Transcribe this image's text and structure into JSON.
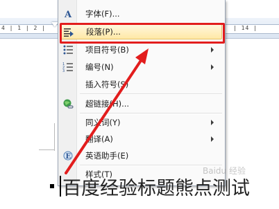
{
  "ruler": {
    "left_numbers": "4 | 1 | 2 |",
    "right_numbers": "| 14 |"
  },
  "context_menu": {
    "items": [
      {
        "label": "字体(F)...",
        "icon": "font-a-icon",
        "has_submenu": false
      },
      {
        "label": "段落(P)...",
        "icon": "paragraph-icon",
        "has_submenu": false,
        "highlighted": true
      },
      {
        "label": "项目符号(B)",
        "icon": "bullet-list-icon",
        "has_submenu": true
      },
      {
        "label": "编号(N)",
        "icon": "numbered-list-icon",
        "has_submenu": true
      },
      {
        "label": "插入符号(S)",
        "icon": "",
        "has_submenu": false
      },
      {
        "label": "超链接(H)...",
        "icon": "hyperlink-globe-icon",
        "has_submenu": false
      },
      {
        "label": "同义词(Y)",
        "icon": "",
        "has_submenu": true
      },
      {
        "label": "翻译(A)",
        "icon": "",
        "has_submenu": true
      },
      {
        "label": "英语助手(E)",
        "icon": "english-assistant-icon",
        "has_submenu": false
      },
      {
        "label": "样式(T)",
        "icon": "",
        "has_submenu": false
      }
    ]
  },
  "document": {
    "text": "百度经验标题熊点测试"
  },
  "watermark": "Baidu 经验",
  "colors": {
    "highlight_border": "#e21d1d",
    "arrow": "#e21d1d",
    "menu_hover": "#ffe8a6"
  }
}
